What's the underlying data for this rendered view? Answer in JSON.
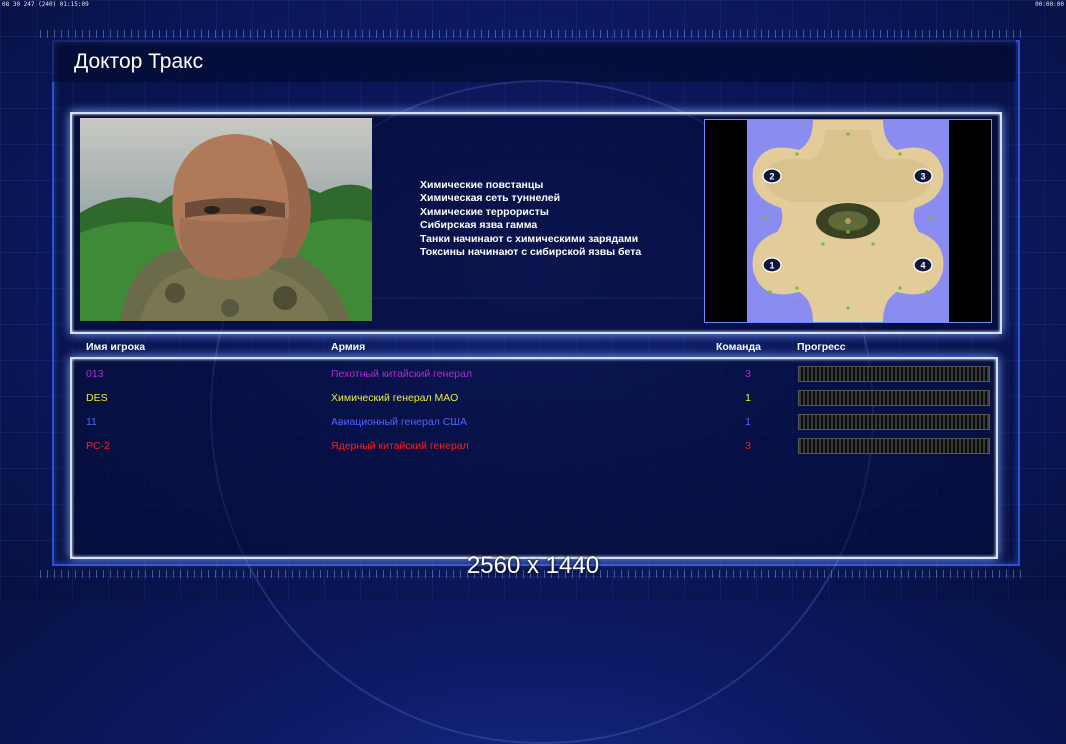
{
  "hud": {
    "left": "08 30 247 (240) 01:15:09",
    "right": "00:00:00"
  },
  "title": "Доктор Тракс",
  "description": [
    "Химические повстанцы",
    "Химическая сеть туннелей",
    "Химические террористы",
    "Сибирская язва гамма",
    "Танки начинают с химическими зарядами",
    "Токсины начинают с сибирской язвы бета"
  ],
  "columns": {
    "player_name": "Имя игрока",
    "army": "Армия",
    "team": "Команда",
    "progress": "Прогресс"
  },
  "players": [
    {
      "name": "013",
      "army": "Пехотный китайский генерал",
      "team": "3",
      "color": "#b02bd0",
      "progress": 0
    },
    {
      "name": "DES",
      "army": "Химический генерал МАО",
      "team": "1",
      "color": "#ecec3a",
      "progress": 0
    },
    {
      "name": "11",
      "army": "Авиационный генерал США",
      "team": "1",
      "color": "#4f66ff",
      "progress": 0
    },
    {
      "name": "PC-2",
      "army": "Ядерный китайский генерал",
      "team": "3",
      "color": "#ff1d1d",
      "progress": 0
    }
  ],
  "map_start_positions": [
    "1",
    "2",
    "3",
    "4"
  ],
  "resolution_label": "2560 x 1440"
}
